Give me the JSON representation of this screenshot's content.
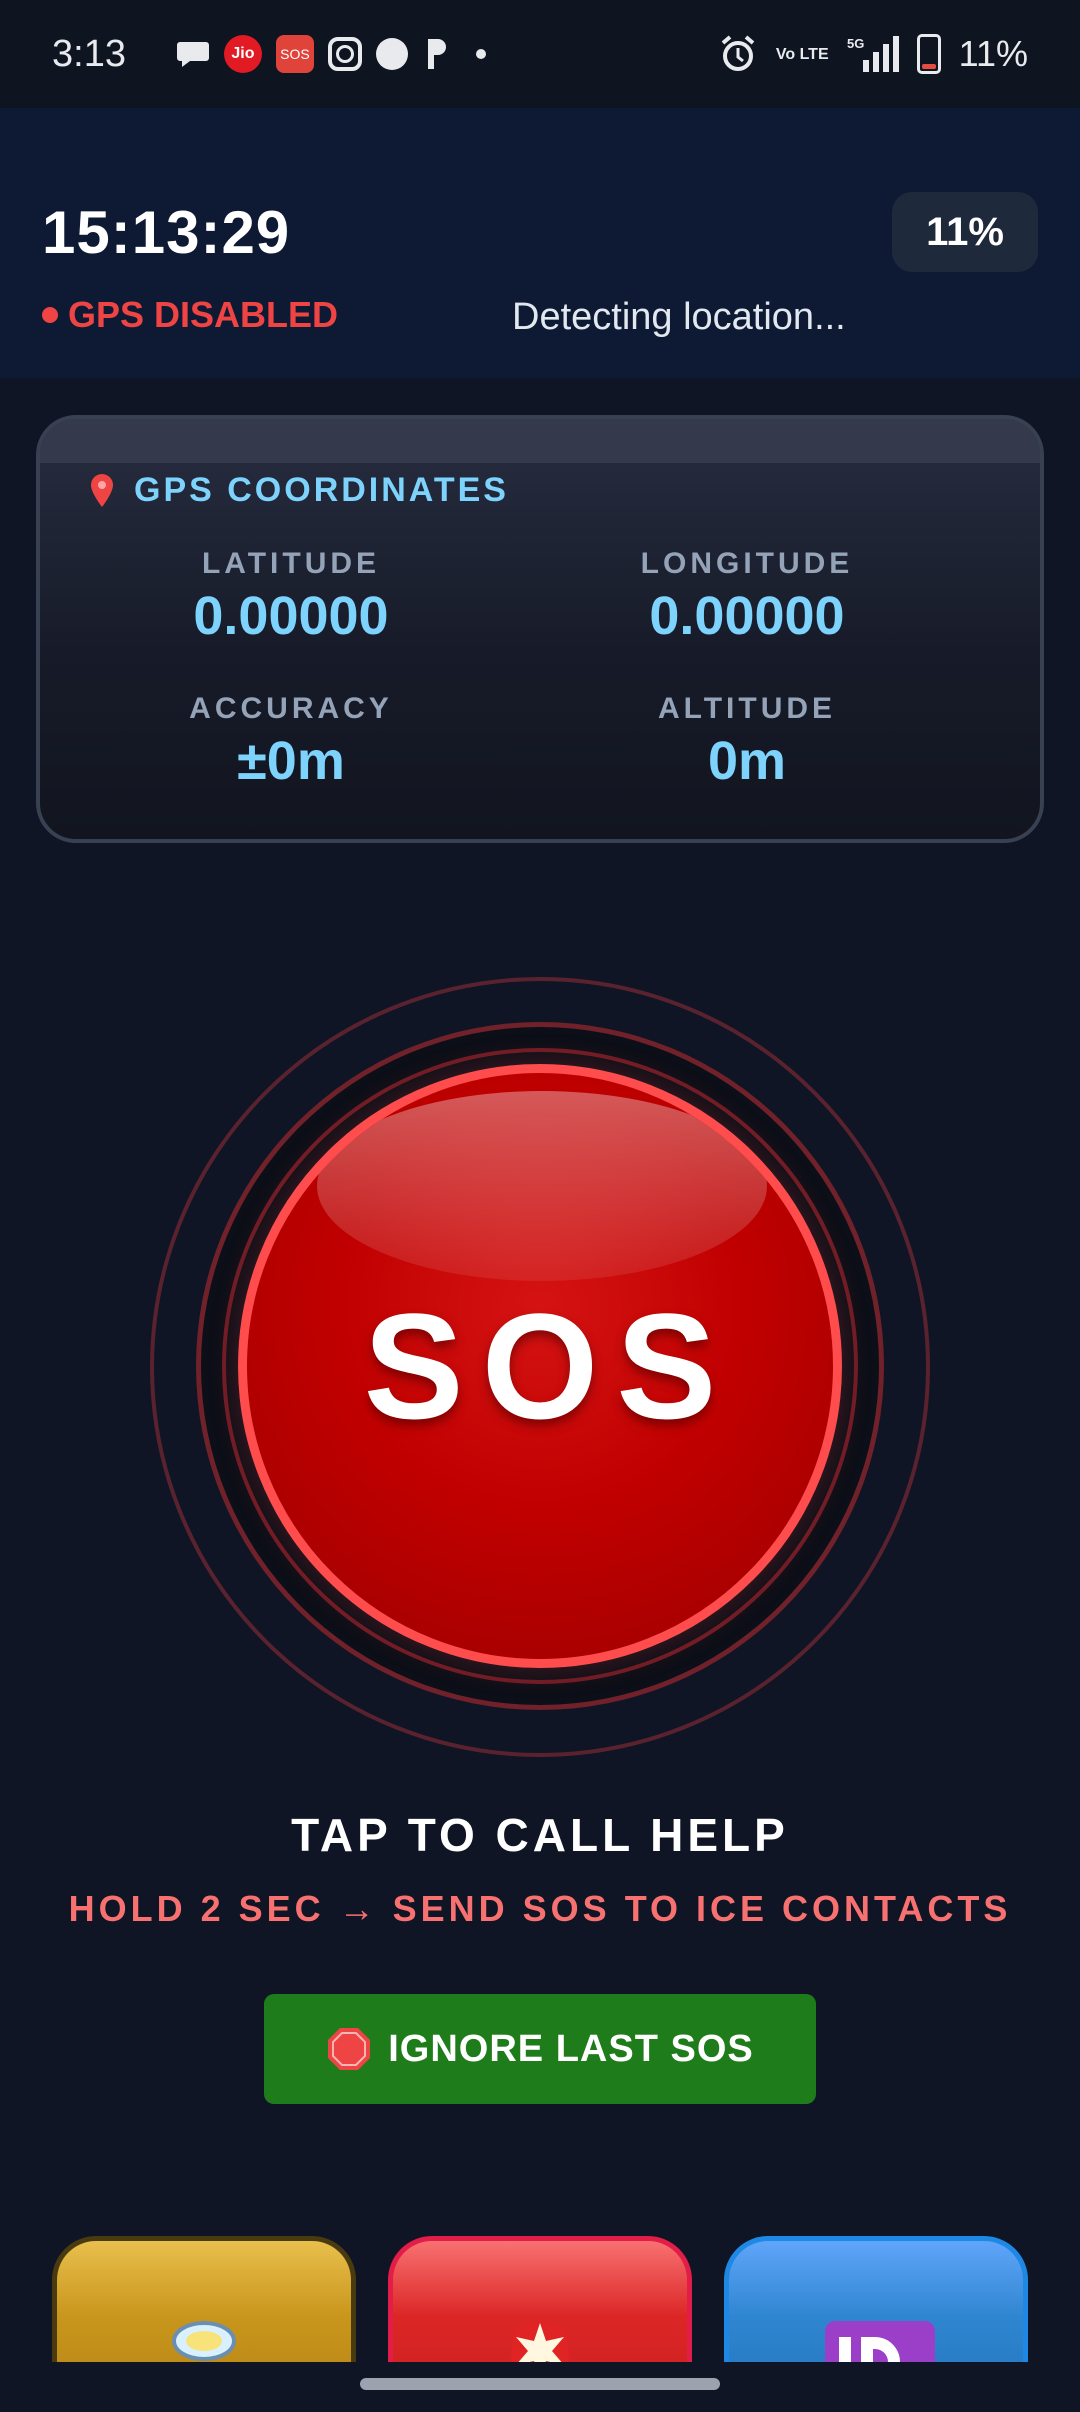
{
  "status_bar": {
    "time": "3:13",
    "jio_label": "Jio",
    "sos_badge": "SOS",
    "volte": "Vo LTE",
    "network": "5G",
    "battery": "11%"
  },
  "header": {
    "clock": "15:13:29",
    "battery_pill": "11%",
    "gps_status": "GPS DISABLED",
    "location_status": "Detecting location..."
  },
  "gps_card": {
    "title": "GPS COORDINATES",
    "latitude_label": "LATITUDE",
    "latitude_value": "0.00000",
    "longitude_label": "LONGITUDE",
    "longitude_value": "0.00000",
    "accuracy_label": "ACCURACY",
    "accuracy_value": "±0m",
    "altitude_label": "ALTITUDE",
    "altitude_value": "0m"
  },
  "sos": {
    "label": "SOS",
    "tap_text": "TAP TO CALL HELP",
    "hold_text": "HOLD 2 SEC → SEND SOS TO ICE CONTACTS"
  },
  "ignore_button": {
    "label": "IGNORE LAST SOS",
    "icon": "stop-sign-icon"
  },
  "tiles": [
    {
      "icon": "flashlight-icon",
      "color": "#c9961c"
    },
    {
      "icon": "siren-icon",
      "color": "#dc2626"
    },
    {
      "icon": "id-card-icon",
      "color": "#2f86d0"
    }
  ],
  "colors": {
    "background": "#0f1524",
    "accent_cyan": "#7dd3fc",
    "alert_red": "#ef4444",
    "sos_red": "#c00000",
    "ignore_green": "#1e7c1a"
  }
}
